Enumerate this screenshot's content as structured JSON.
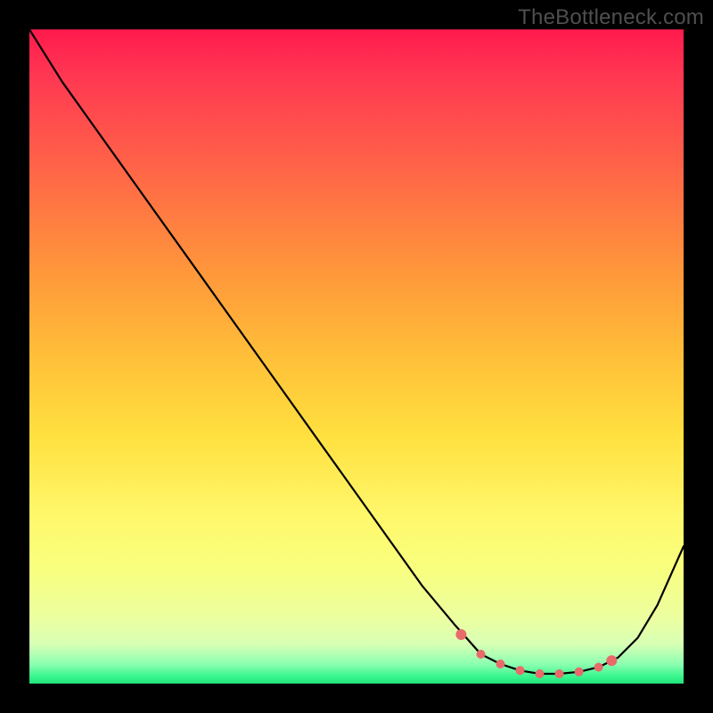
{
  "watermark": "TheBottleneck.com",
  "chart_data": {
    "type": "line",
    "title": "",
    "xlabel": "",
    "ylabel": "",
    "xlim": [
      0,
      100
    ],
    "ylim": [
      0,
      100
    ],
    "series": [
      {
        "name": "bottleneck-curve",
        "x": [
          0,
          5,
          10,
          15,
          20,
          25,
          30,
          35,
          40,
          45,
          50,
          55,
          60,
          65,
          69,
          72,
          75,
          78,
          81,
          84,
          87,
          90,
          93,
          96,
          100
        ],
        "values": [
          100,
          92,
          85,
          78,
          71,
          64,
          57,
          50,
          43,
          36,
          29,
          22,
          15,
          9,
          4.5,
          3,
          2,
          1.5,
          1.5,
          1.8,
          2.5,
          4,
          7,
          12,
          21
        ]
      }
    ],
    "markers": {
      "name": "highlight-dots",
      "color": "#e86a6a",
      "x": [
        66,
        69,
        72,
        75,
        78,
        81,
        84,
        87,
        89
      ],
      "values": [
        7.5,
        4.5,
        3,
        2,
        1.5,
        1.5,
        1.8,
        2.5,
        3.5
      ]
    }
  }
}
